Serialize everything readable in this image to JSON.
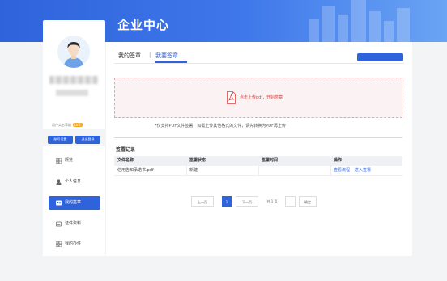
{
  "header": {
    "title": "企业中心"
  },
  "profile": {
    "auth_label": "用户实名等级",
    "auth_badge": "LV.2",
    "buttons": [
      "账号设置",
      "退出登录"
    ]
  },
  "sidebar": {
    "items": [
      {
        "label": "概览",
        "icon": "grid-icon",
        "active": false
      },
      {
        "label": "个人信息",
        "icon": "user-icon",
        "active": false
      },
      {
        "label": "我的签章",
        "icon": "seal-icon",
        "active": true
      },
      {
        "label": "证件资料",
        "icon": "inbox-icon",
        "active": false
      },
      {
        "label": "我的办件",
        "icon": "grid-icon",
        "active": false
      }
    ]
  },
  "main": {
    "tabs": [
      {
        "label": "我的签章",
        "active": false
      },
      {
        "label": "我要签章",
        "active": true
      }
    ],
    "tab_separator": "|",
    "top_button": "",
    "upload": {
      "text": "点击上传pdf，开始签章",
      "icon": "pdf-file-icon"
    },
    "tip": "*仅支持PDF文件签署，如需上传其他格式的文件，请先转换为PDF再上传",
    "records_title": "签署记录",
    "table": {
      "headers": [
        "文件名称",
        "签署状态",
        "签署时间",
        "操作"
      ],
      "rows": [
        {
          "name": "信用告知承诺书.pdf",
          "status": "新建",
          "time": "",
          "actions": [
            "查看流程",
            "进入签署"
          ]
        }
      ]
    },
    "pager": {
      "prev": "上一页",
      "current": "1",
      "next": "下一页",
      "total": "共 1 页",
      "goto_value": "",
      "confirm": "确定"
    }
  },
  "colors": {
    "brand": "#2f63dc",
    "upload_text": "#e04040",
    "badge": "#f5a623"
  }
}
